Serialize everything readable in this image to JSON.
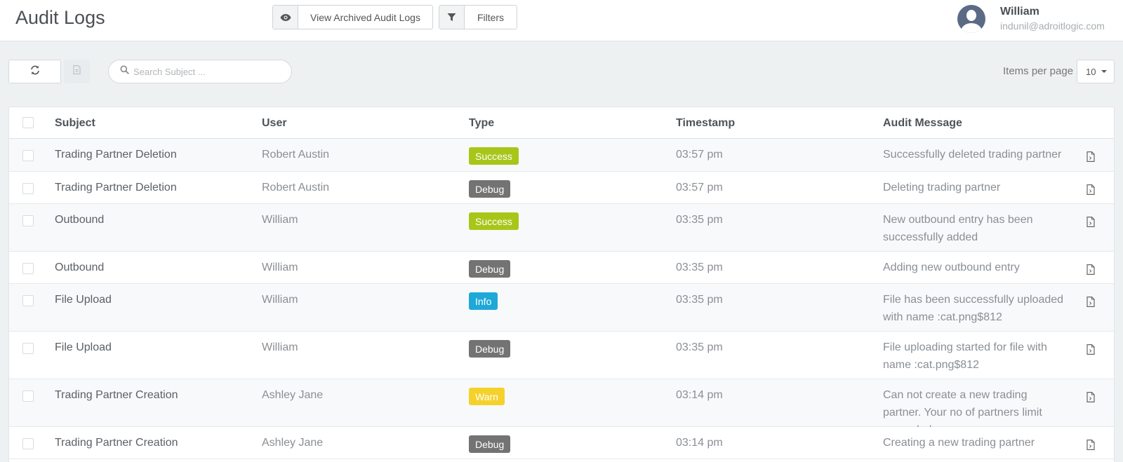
{
  "header": {
    "title": "Audit Logs",
    "archived_label": "View Archived Audit Logs",
    "filters_label": "Filters",
    "user_name": "William",
    "user_email": "indunil@adroitlogic.com"
  },
  "toolbar": {
    "search_placeholder": "Search Subject ...",
    "items_per_page_label": "Items per page",
    "items_per_page_value": "10"
  },
  "table": {
    "columns": [
      "Subject",
      "User",
      "Type",
      "Timestamp",
      "Audit Message"
    ],
    "rows": [
      {
        "subject": "Trading Partner Deletion",
        "user": "Robert Austin",
        "type": "Success",
        "timestamp": "03:57 pm",
        "message": "Successfully deleted trading partner"
      },
      {
        "subject": "Trading Partner Deletion",
        "user": "Robert Austin",
        "type": "Debug",
        "timestamp": "03:57 pm",
        "message": "Deleting trading partner"
      },
      {
        "subject": "Outbound",
        "user": "William",
        "type": "Success",
        "timestamp": "03:35 pm",
        "message": "New outbound entry has been successfully added"
      },
      {
        "subject": "Outbound",
        "user": "William",
        "type": "Debug",
        "timestamp": "03:35 pm",
        "message": "Adding new outbound entry"
      },
      {
        "subject": "File Upload",
        "user": "William",
        "type": "Info",
        "timestamp": "03:35 pm",
        "message": "File has been successfully uploaded with name :cat.png$812"
      },
      {
        "subject": "File Upload",
        "user": "William",
        "type": "Debug",
        "timestamp": "03:35 pm",
        "message": "File uploading started for file with name :cat.png$812"
      },
      {
        "subject": "Trading Partner Creation",
        "user": "Ashley Jane",
        "type": "Warn",
        "timestamp": "03:14 pm",
        "message": "Can not create a new trading partner. Your no of partners limit exceeded."
      },
      {
        "subject": "Trading Partner Creation",
        "user": "Ashley Jane",
        "type": "Debug",
        "timestamp": "03:14 pm",
        "message": "Creating a new trading partner"
      }
    ]
  },
  "colors": {
    "Success": "#a8c61a",
    "Debug": "#737373",
    "Info": "#1ea8d8",
    "Warn": "#f5d22b"
  },
  "icons": [
    "eye-icon",
    "filter-icon",
    "refresh-icon",
    "export-icon",
    "search-icon",
    "document-icon",
    "avatar-icon"
  ]
}
